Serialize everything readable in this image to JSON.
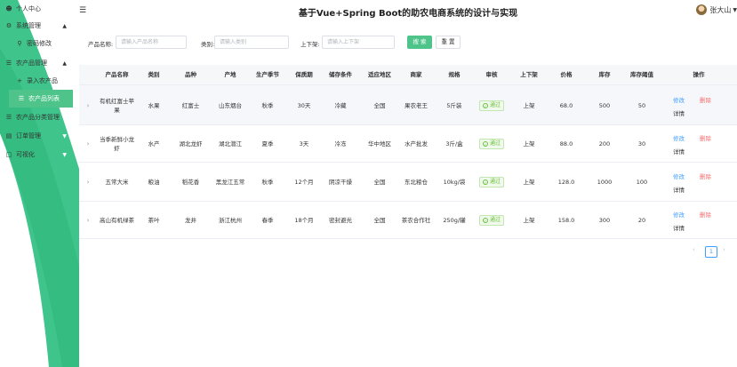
{
  "header": {
    "title": "基于Vue+Spring Boot的助农电商系统的设计与实现",
    "user_name": "张大山",
    "menu_icon": "hamburger-icon"
  },
  "sidebar": {
    "items": [
      {
        "label": "个人中心",
        "icon": "user-icon"
      },
      {
        "label": "系统管理",
        "icon": "gear-icon"
      },
      {
        "label": "密码修改",
        "icon": "key-icon"
      },
      {
        "label": "农产品管理",
        "icon": "list-icon"
      },
      {
        "label": "录入农产品",
        "icon": "plus-icon"
      },
      {
        "label": "农产品列表",
        "icon": "menu-icon"
      },
      {
        "label": "农产品分类管理",
        "icon": "list-icon"
      },
      {
        "label": "订单管理",
        "icon": "document-icon"
      },
      {
        "label": "可视化",
        "icon": "chart-icon"
      }
    ],
    "accent": "#4ec48b"
  },
  "search": {
    "name_label": "产品名称:",
    "name_placeholder": "请输入产品名称",
    "category_label": "类别:",
    "category_placeholder": "请输入类别",
    "status_label": "上下架:",
    "status_placeholder": "请输入上下架",
    "search_button": "搜 索",
    "reset_button": "重 置"
  },
  "table": {
    "columns": [
      "产品名称",
      "类别",
      "品种",
      "产地",
      "生产季节",
      "保质期",
      "储存条件",
      "适应地区",
      "商家",
      "规格",
      "审核",
      "上下架",
      "价格",
      "库存",
      "库存阈值",
      "操作"
    ],
    "rows": [
      {
        "name": "有机红富士苹果",
        "category": "水果",
        "variety": "红富士",
        "origin": "山东烟台",
        "season": "秋季",
        "shelf_life": "30天",
        "storage": "冷藏",
        "region": "全国",
        "merchant": "果农老王",
        "spec": "5斤装",
        "audit": "通过",
        "status": "上架",
        "price": "68.0",
        "stock": "500",
        "threshold": "50"
      },
      {
        "name": "当季新鲜小龙虾",
        "category": "水产",
        "variety": "湖北龙虾",
        "origin": "湖北潜江",
        "season": "夏季",
        "shelf_life": "3天",
        "storage": "冷冻",
        "region": "华中地区",
        "merchant": "水产批发",
        "spec": "3斤/盒",
        "audit": "通过",
        "status": "上架",
        "price": "88.0",
        "stock": "200",
        "threshold": "30"
      },
      {
        "name": "五常大米",
        "category": "粮油",
        "variety": "稻花香",
        "origin": "黑龙江五常",
        "season": "秋季",
        "shelf_life": "12个月",
        "storage": "阴凉干燥",
        "region": "全国",
        "merchant": "东北粮仓",
        "spec": "10kg/袋",
        "audit": "通过",
        "status": "上架",
        "price": "128.0",
        "stock": "1000",
        "threshold": "100"
      },
      {
        "name": "高山有机绿茶",
        "category": "茶叶",
        "variety": "龙井",
        "origin": "浙江杭州",
        "season": "春季",
        "shelf_life": "18个月",
        "storage": "密封避光",
        "region": "全国",
        "merchant": "茶农合作社",
        "spec": "250g/罐",
        "audit": "通过",
        "status": "上架",
        "price": "158.0",
        "stock": "300",
        "threshold": "20"
      }
    ],
    "actions": {
      "edit": "修改",
      "delete": "删除",
      "detail": "详情"
    }
  },
  "pagination": {
    "current_page": "1",
    "prev_icon": "chevron-left-icon",
    "next_icon": "chevron-right-icon"
  }
}
